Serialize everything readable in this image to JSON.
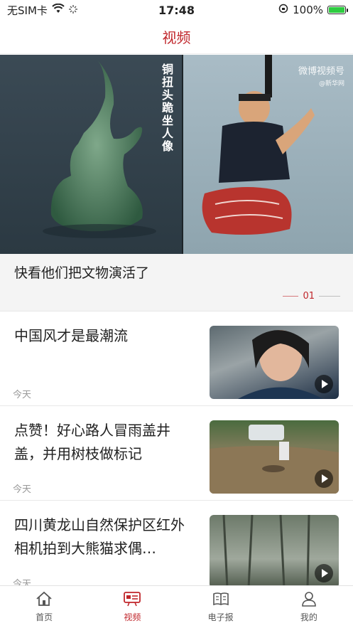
{
  "status_bar": {
    "carrier": "无SIM卡",
    "time": "17:48",
    "battery": "100%",
    "battery_level": 1.0
  },
  "header": {
    "title": "视频"
  },
  "hero": {
    "vertical_label": "铜扭头跪坐人像",
    "watermark": "微博视频号",
    "watermark_sub": "@新华网",
    "caption": "快看他们把文物演活了",
    "page_index": "01"
  },
  "news": [
    {
      "title": "中国风才是最潮流",
      "time": "今天"
    },
    {
      "title": "点赞！好心路人冒雨盖井盖，并用树枝做标记",
      "time": "今天"
    },
    {
      "title": "四川黄龙山自然保护区红外相机拍到大熊猫求偶…",
      "time": "今天"
    }
  ],
  "tabbar": {
    "items": [
      {
        "label": "首页"
      },
      {
        "label": "视频"
      },
      {
        "label": "电子报"
      },
      {
        "label": "我的"
      }
    ],
    "active_color": "#c0262b"
  }
}
